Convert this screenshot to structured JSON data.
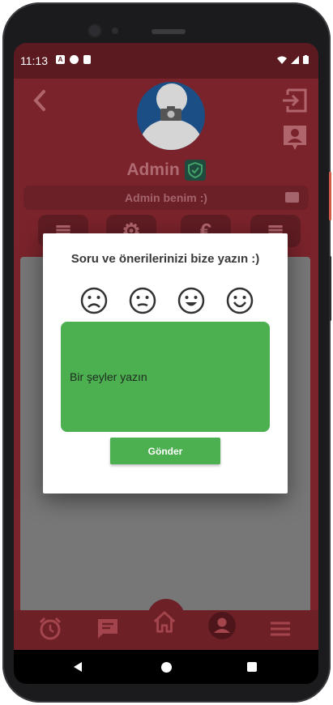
{
  "statusbar": {
    "time": "11:13",
    "icon_a": "A"
  },
  "profile": {
    "name": "Admin",
    "bio": "Admin benim :)"
  },
  "tiles": [
    {
      "glyph": "≣",
      "icon": "list-icon"
    },
    {
      "glyph": "⚙",
      "icon": "gear-icon"
    },
    {
      "glyph": "€",
      "icon": "euro-icon"
    },
    {
      "glyph": "≣",
      "icon": "message-icon"
    }
  ],
  "dialog": {
    "title": "Soru ve önerilerinizi bize yazın :)",
    "placeholder": "Bir şeyler yazın",
    "send_label": "Gönder",
    "faces": [
      "sad-face",
      "neutral-face",
      "smile-face",
      "happy-face"
    ]
  },
  "colors": {
    "accent_green": "#4caf50",
    "app_maroon": "#7a232b"
  }
}
